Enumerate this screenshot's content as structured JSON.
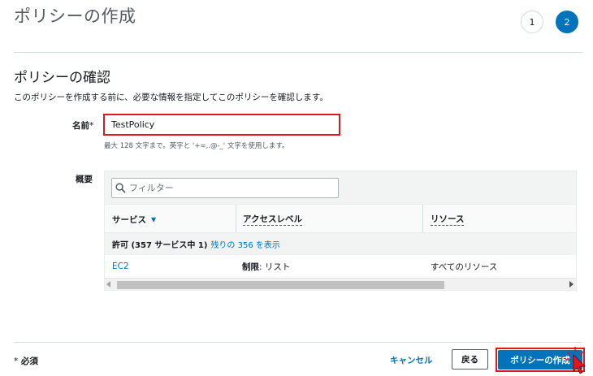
{
  "header": {
    "page_title": "ポリシーの作成",
    "steps": [
      "1",
      "2"
    ],
    "active_step": "2"
  },
  "review": {
    "section_title": "ポリシーの確認",
    "description": "このポリシーを作成する前に、必要な情報を指定してこのポリシーを確認します。",
    "name_label": "名前",
    "name_required_mark": "*",
    "name_value": "TestPolicy",
    "name_hint": "最大 128 文字まで。英字と '+=,.@-_' 文字を使用します。",
    "summary_label": "概要"
  },
  "summary_table": {
    "filter_placeholder": "フィルター",
    "columns": [
      "サービス",
      "アクセスレベル",
      "リソース"
    ],
    "group": {
      "label": "許可 (357 サービス中 1)",
      "link": "残りの 356 を表示"
    },
    "rows": [
      {
        "service": "EC2",
        "access_level_prefix": "制限",
        "access_level_rest": ": リスト",
        "resource": "すべてのリソース"
      }
    ]
  },
  "footer": {
    "required_note_star": "*",
    "required_note": "必須",
    "cancel_label": "キャンセル",
    "back_label": "戻る",
    "create_label": "ポリシーの作成"
  },
  "colors": {
    "primary": "#0073bb",
    "highlight": "#e0171e"
  }
}
